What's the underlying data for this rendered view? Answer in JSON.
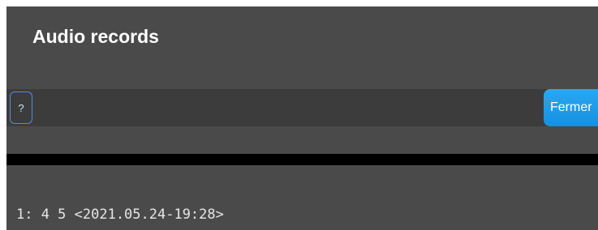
{
  "dialog": {
    "title": "Audio records"
  },
  "toolbar": {
    "help_label": "?",
    "close_label": "Fermer"
  },
  "records": [
    "1: 4 5 <2021.05.24-19:28>"
  ]
}
